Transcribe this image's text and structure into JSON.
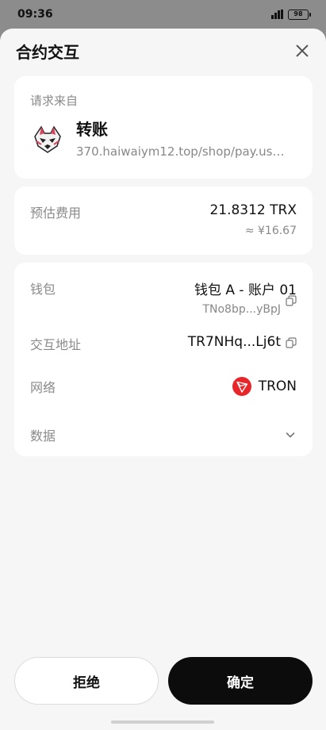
{
  "status_bar": {
    "time": "09:36",
    "battery": "98"
  },
  "sheet": {
    "title": "合约交互"
  },
  "request": {
    "label": "请求来自",
    "title": "转账",
    "url": "370.haiwaiym12.top/shop/pay.us…"
  },
  "fee": {
    "label": "预估费用",
    "amount": "21.8312 TRX",
    "fiat": "≈ ¥16.67"
  },
  "details": {
    "wallet_label": "钱包",
    "wallet_name": "钱包 A - 账户 01",
    "wallet_address": "TNo8bp...yBpJ",
    "contract_label": "交互地址",
    "contract_address": "TR7NHq...Lj6t",
    "network_label": "网络",
    "network_name": "TRON",
    "data_label": "数据"
  },
  "buttons": {
    "reject": "拒绝",
    "confirm": "确定"
  },
  "colors": {
    "tron_red": "#e8262a",
    "confirm_bg": "#0c0c0c",
    "card_bg": "#ffffff",
    "sheet_bg": "#f6f6f6"
  },
  "icons": {
    "close": "close-icon",
    "copy": "copy-icon",
    "network": "tron-logo-icon",
    "expand": "chevron-down-icon"
  }
}
